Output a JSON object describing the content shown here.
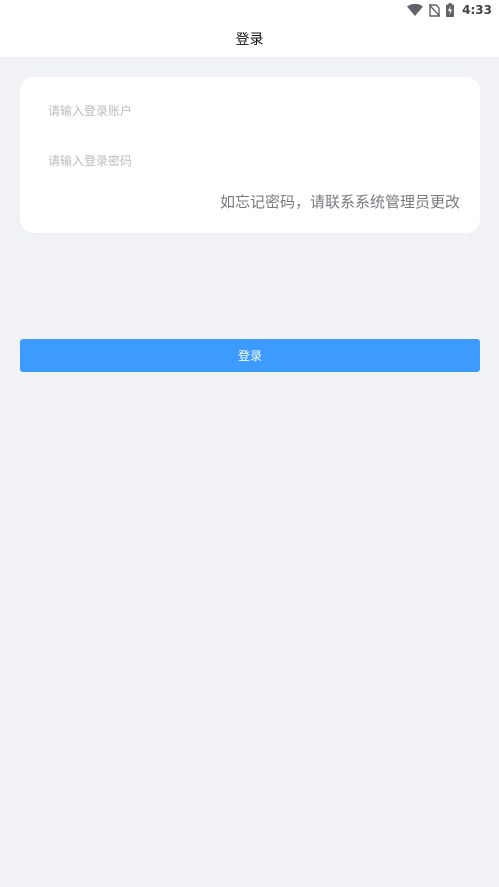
{
  "status_bar": {
    "time": "4:33",
    "icons": [
      "wifi-icon",
      "no-sim-icon",
      "battery-charging-icon"
    ]
  },
  "nav": {
    "title": "登录"
  },
  "form": {
    "account_placeholder": "请输入登录账户",
    "password_placeholder": "请输入登录密码",
    "hint": "如忘记密码，请联系系统管理员更改"
  },
  "actions": {
    "login_label": "登录"
  },
  "colors": {
    "background": "#f1f2f5",
    "accent": "#3d9bff",
    "card": "#ffffff"
  }
}
